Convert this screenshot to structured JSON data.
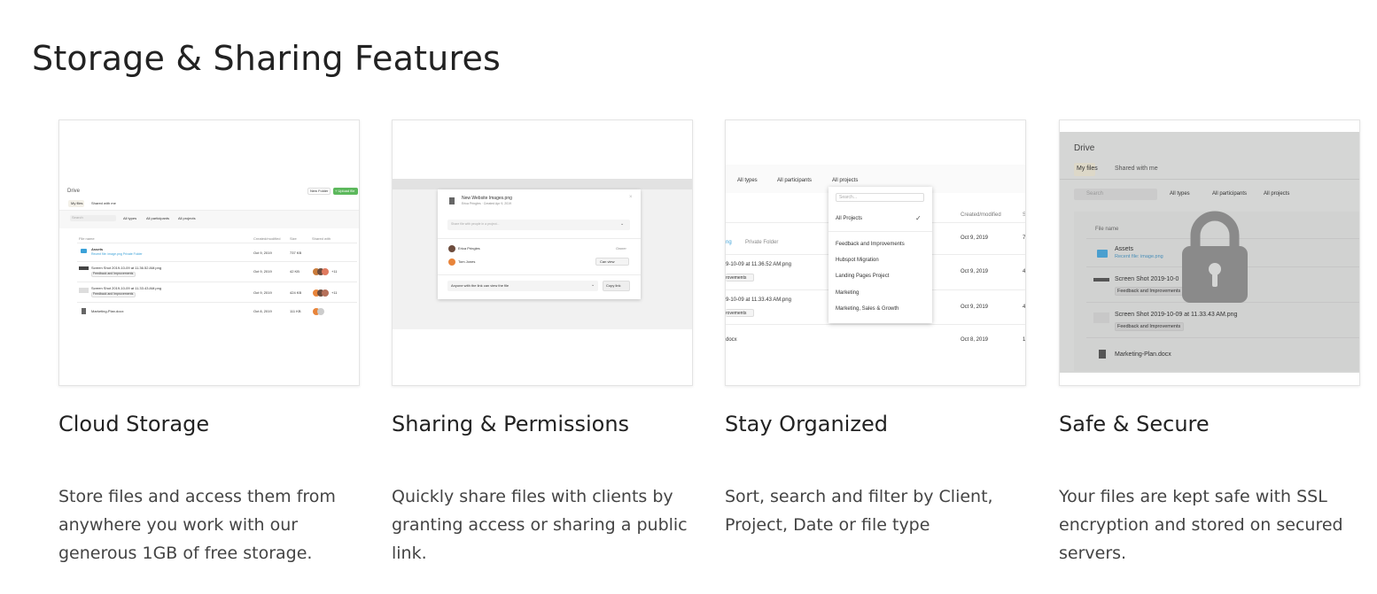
{
  "page": {
    "title": "Storage & Sharing Features"
  },
  "cards": [
    {
      "title": "Cloud Storage",
      "description": "Store files and access them from anywhere you work with our generous 1GB of free storage.",
      "shot": {
        "drive_title": "Drive",
        "new_folder": "New Folder",
        "upload": "+ Upload file",
        "tab_my_files": "My files",
        "tab_shared": "Shared with me",
        "search_placeholder": "Search",
        "filter_types": "All types",
        "filter_participants": "All participants",
        "filter_projects": "All projects",
        "col_file_name": "File name",
        "col_created": "Created/modified",
        "col_size": "Size",
        "col_shared": "Shared with",
        "rows": [
          {
            "name": "Assets",
            "sub": "Recent file: image.png  Private Folder",
            "date": "Oct 9, 2019",
            "size": "737 KB"
          },
          {
            "name": "Screen Shot 2019-10-09 at 11.36.52 AM.png",
            "tag": "Feedback and Improvements",
            "date": "Oct 9, 2019",
            "size": "42 KB",
            "extra": "+11"
          },
          {
            "name": "Screen Shot 2019-10-09 at 11.33.43 AM.png",
            "tag": "Feedback and Improvements",
            "date": "Oct 9, 2019",
            "size": "424 KB",
            "extra": "+11"
          },
          {
            "name": "Marketing-Plan.docx",
            "date": "Oct 8, 2019",
            "size": "111 KB"
          }
        ]
      }
    },
    {
      "title": "Sharing & Permissions",
      "description": "Quickly share files with clients by granting access or sharing a public link.",
      "shot": {
        "file_name": "New Website Images.png",
        "file_meta": "Erica Pringles  ·  Created Apr 9, 2019",
        "share_placeholder": "Share file with people in a project...",
        "person1": "Erica Pringles",
        "person1_role": "Owner",
        "person2": "Tom Jones",
        "person2_role": "Can view",
        "link_text": "Anyone with the link can view the file",
        "copy_link": "Copy link"
      }
    },
    {
      "title": "Stay Organized",
      "description": "Sort, search and filter by Client, Project, Date or file type",
      "shot": {
        "filter_types": "All types",
        "filter_participants": "All participants",
        "filter_projects": "All projects",
        "search_placeholder": "Search...",
        "col_created": "Created/modified",
        "col_size": "Si",
        "menu": [
          "All Projects",
          "Feedback and Improvements",
          "Hubspot Migration",
          "Landing Pages Project",
          "Marketing",
          "Marketing, Sales & Growth"
        ],
        "rows": [
          {
            "name": "ng",
            "sub": "Private Folder",
            "date": "Oct 9, 2019",
            "size": "7"
          },
          {
            "name": "9-10-09 at 11.36.52 AM.png",
            "tag": "rovements",
            "date": "Oct 9, 2019",
            "size": "4"
          },
          {
            "name": "9-10-09 at 11.33.43 AM.png",
            "tag": "rovements",
            "date": "Oct 9, 2019",
            "size": "4"
          },
          {
            "name": "docx",
            "date": "Oct 8, 2019",
            "size": "1"
          }
        ]
      }
    },
    {
      "title": "Safe & Secure",
      "description": "Your files are kept safe with SSL encryption and stored on secured servers.",
      "shot": {
        "drive_title": "Drive",
        "tab_my_files": "My files",
        "tab_shared": "Shared with me",
        "search_placeholder": "Search",
        "filter_types": "All types",
        "filter_participants": "All participants",
        "filter_projects": "All projects",
        "col_file_name": "File name",
        "rows": [
          {
            "name": "Assets",
            "sub": "Recent file: image.png"
          },
          {
            "name": "Screen Shot 2019-10-0",
            "tag": "Feedback and Improvements"
          },
          {
            "name": "Screen Shot 2019-10-09 at 11.33.43 AM.png",
            "tag": "Feedback and Improvements"
          },
          {
            "name": "Marketing-Plan.docx"
          }
        ],
        "lock_icon": "lock-icon"
      }
    }
  ]
}
